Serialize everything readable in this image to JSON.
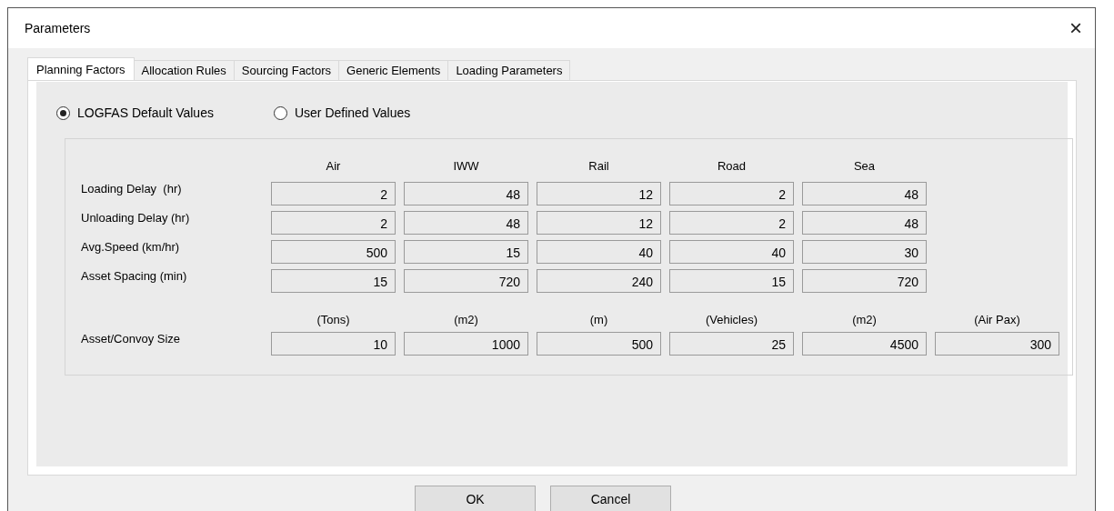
{
  "window": {
    "title": "Parameters",
    "close": "×"
  },
  "tabs": [
    {
      "label": "Planning Factors",
      "selected": true
    },
    {
      "label": "Allocation Rules",
      "selected": false
    },
    {
      "label": "Sourcing Factors",
      "selected": false
    },
    {
      "label": "Generic Elements",
      "selected": false
    },
    {
      "label": "Loading Parameters",
      "selected": false
    }
  ],
  "value_source": [
    {
      "label": "LOGFAS Default Values",
      "selected": true
    },
    {
      "label": "User Defined Values",
      "selected": false
    }
  ],
  "columns": [
    "Air",
    "IWW",
    "Rail",
    "Road",
    "Sea"
  ],
  "rows": [
    {
      "label": "Loading Delay  (hr)",
      "values": [
        "2",
        "48",
        "12",
        "2",
        "48"
      ]
    },
    {
      "label": "Unloading Delay (hr)",
      "values": [
        "2",
        "48",
        "12",
        "2",
        "48"
      ]
    },
    {
      "label": "Avg.Speed (km/hr)",
      "values": [
        "500",
        "15",
        "40",
        "40",
        "30"
      ]
    },
    {
      "label": "Asset Spacing (min)",
      "values": [
        "15",
        "720",
        "240",
        "15",
        "720"
      ]
    }
  ],
  "size_units": [
    "(Tons)",
    "(m2)",
    "(m)",
    "(Vehicles)",
    "(m2)",
    "(Air Pax)"
  ],
  "size_row": {
    "label": "Asset/Convoy Size",
    "values": [
      "10",
      "1000",
      "500",
      "25",
      "4500",
      "300"
    ]
  },
  "buttons": [
    "OK",
    "Cancel"
  ]
}
